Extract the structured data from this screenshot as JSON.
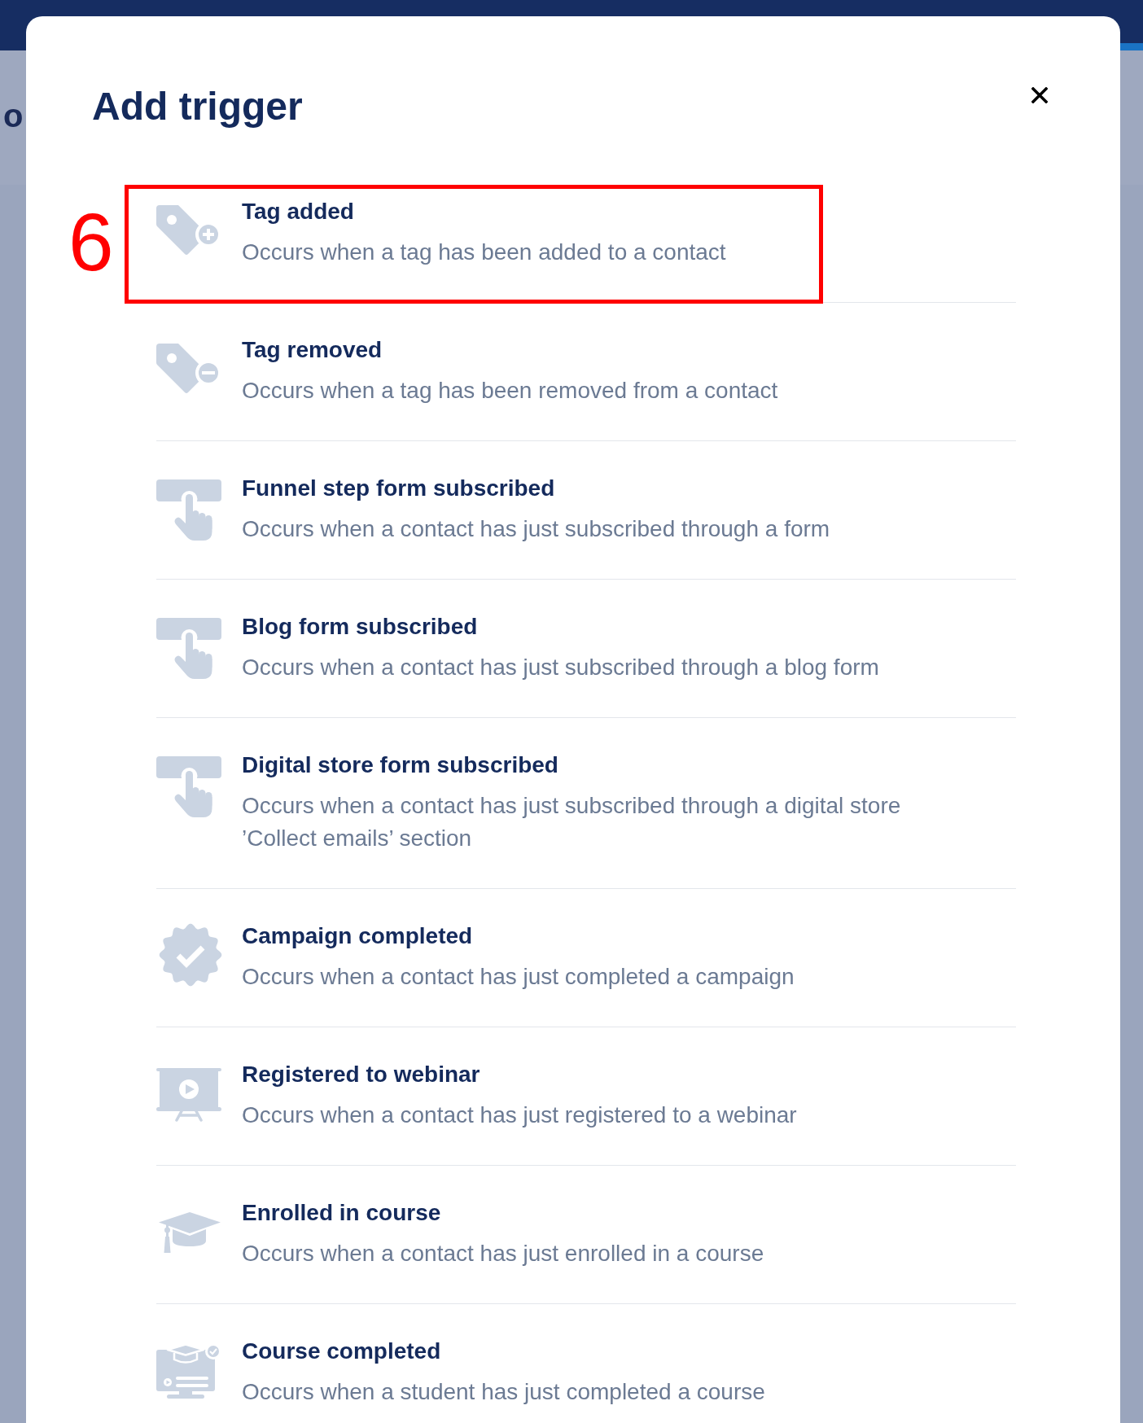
{
  "background": {
    "heading_fragment": "o"
  },
  "dialog": {
    "title": "Add trigger"
  },
  "annotation": {
    "label": "6"
  },
  "triggers": [
    {
      "kind": "tag_added",
      "title": "Tag added",
      "description": "Occurs when a tag has been added to a contact",
      "highlighted": true
    },
    {
      "kind": "tag_removed",
      "title": "Tag removed",
      "description": "Occurs when a tag has been removed from a contact",
      "highlighted": false
    },
    {
      "kind": "form_subscribed",
      "title": "Funnel step form subscribed",
      "description": "Occurs when a contact has just subscribed through a form",
      "highlighted": false
    },
    {
      "kind": "form_subscribed",
      "title": "Blog form subscribed",
      "description": "Occurs when a contact has just subscribed through a blog form",
      "highlighted": false
    },
    {
      "kind": "form_subscribed",
      "title": "Digital store form subscribed",
      "description": "Occurs when a contact has just subscribed through a digital store ’Collect emails’ section",
      "highlighted": false
    },
    {
      "kind": "campaign_completed",
      "title": "Campaign completed",
      "description": "Occurs when a contact has just completed a campaign",
      "highlighted": false
    },
    {
      "kind": "webinar_registered",
      "title": "Registered to webinar",
      "description": "Occurs when a contact has just registered to a webinar",
      "highlighted": false
    },
    {
      "kind": "course_enrolled",
      "title": "Enrolled in course",
      "description": "Occurs when a contact has just enrolled in a course",
      "highlighted": false
    },
    {
      "kind": "course_completed",
      "title": "Course completed",
      "description": "Occurs when a student has just completed a course",
      "highlighted": false
    }
  ]
}
